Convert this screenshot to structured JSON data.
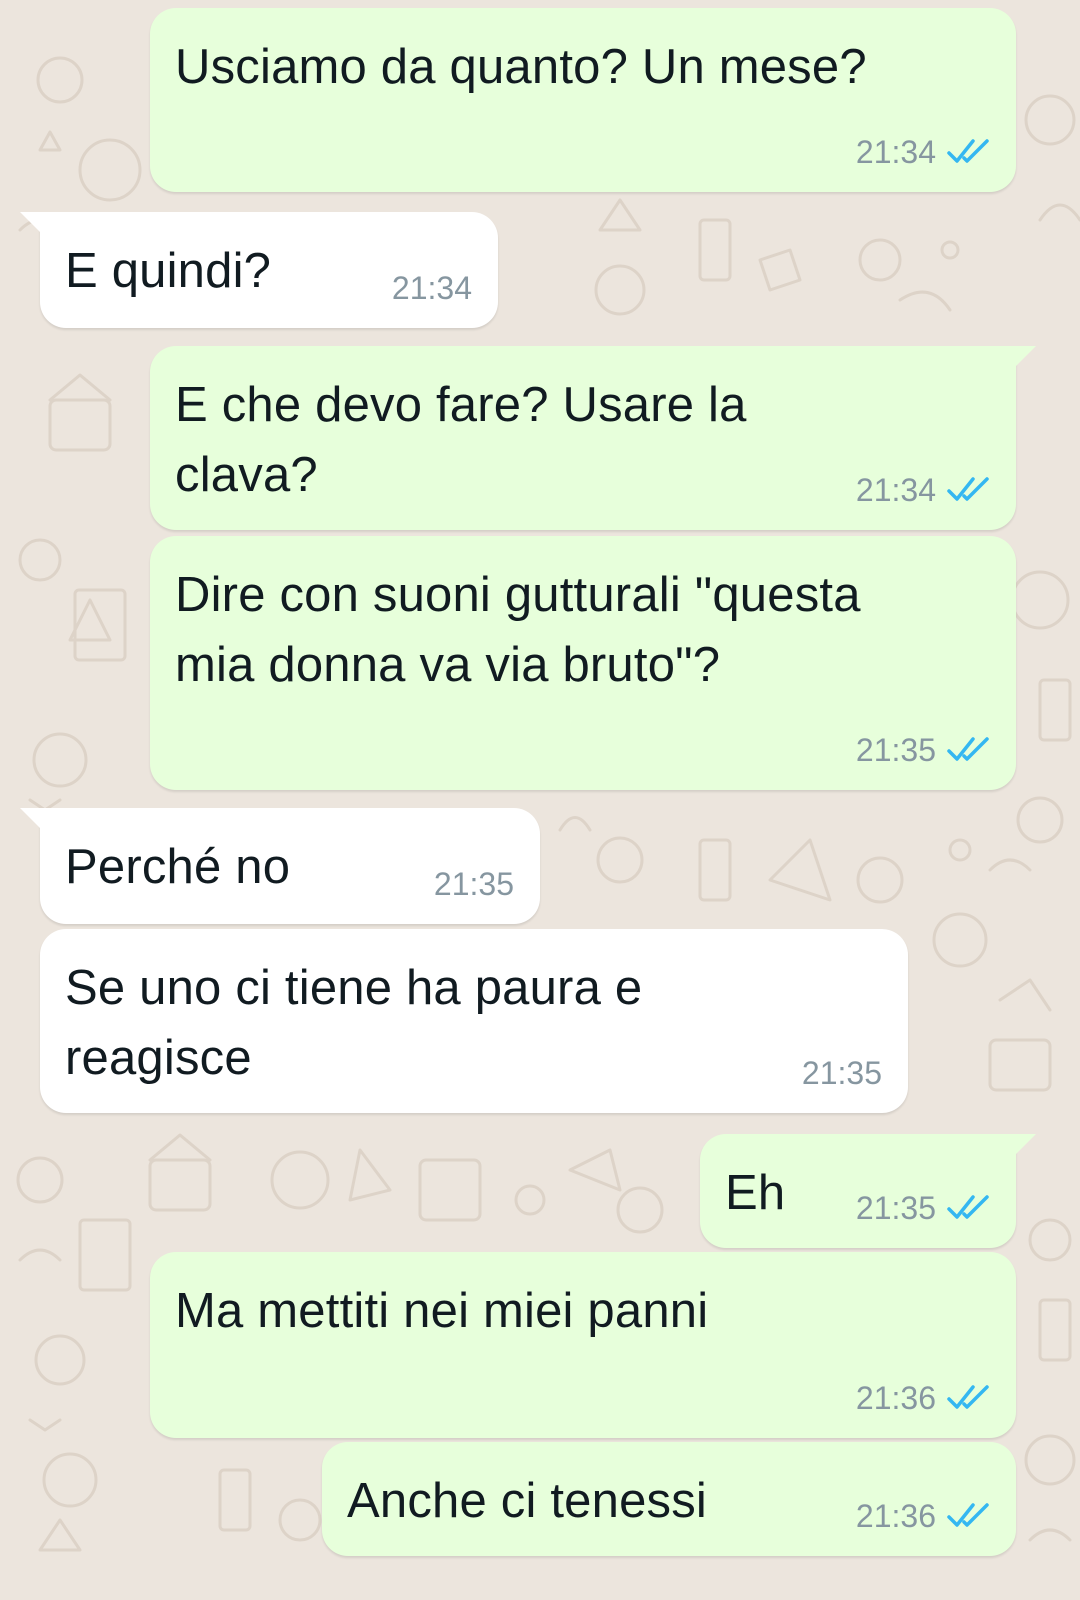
{
  "colors": {
    "background": "#ece5dd",
    "outgoing_bubble": "#e7ffdb",
    "incoming_bubble": "#ffffff",
    "text": "#111b21",
    "timestamp": "#8696a0",
    "read_ticks": "#34b7f1"
  },
  "messages": [
    {
      "direction": "outgoing",
      "text_lines": [
        "Usciamo da quanto? Un mese?"
      ],
      "time": "21:34",
      "status_icon": "double-check-read-icon"
    },
    {
      "direction": "incoming",
      "text_lines": [
        "E quindi?"
      ],
      "time": "21:34"
    },
    {
      "direction": "outgoing",
      "text_lines": [
        "E che devo fare? Usare la",
        "clava?"
      ],
      "time": "21:34",
      "status_icon": "double-check-read-icon"
    },
    {
      "direction": "outgoing",
      "text_lines": [
        "Dire con suoni gutturali \"questa",
        "mia donna va via bruto\"?"
      ],
      "time": "21:35",
      "status_icon": "double-check-read-icon"
    },
    {
      "direction": "incoming",
      "text_lines": [
        "Perché no"
      ],
      "time": "21:35"
    },
    {
      "direction": "incoming",
      "text_lines": [
        "Se uno ci tiene ha paura e",
        "reagisce"
      ],
      "time": "21:35"
    },
    {
      "direction": "outgoing",
      "text_lines": [
        "Eh"
      ],
      "time": "21:35",
      "status_icon": "double-check-read-icon"
    },
    {
      "direction": "outgoing",
      "text_lines": [
        "Ma mettiti nei miei panni"
      ],
      "time": "21:36",
      "status_icon": "double-check-read-icon"
    },
    {
      "direction": "outgoing",
      "text_lines": [
        "Anche ci tenessi"
      ],
      "time": "21:36",
      "status_icon": "double-check-read-icon"
    }
  ]
}
